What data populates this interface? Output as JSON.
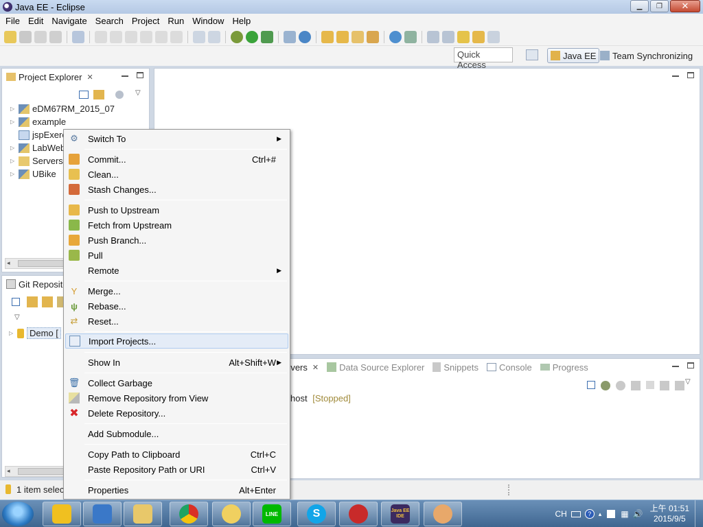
{
  "window": {
    "title": "Java EE - Eclipse"
  },
  "menubar": [
    "File",
    "Edit",
    "Navigate",
    "Search",
    "Project",
    "Run",
    "Window",
    "Help"
  ],
  "quick_access": {
    "placeholder": "Quick Access"
  },
  "perspectives": [
    "Java EE",
    "Team Synchronizing"
  ],
  "project_explorer": {
    "title": "Project Explorer",
    "items": [
      {
        "label": "eDM67RM_2015_07",
        "icon": "web-project-icon",
        "expandable": true
      },
      {
        "label": "example",
        "icon": "web-project-icon",
        "expandable": true
      },
      {
        "label": "jspExerc",
        "icon": "folder-icon",
        "expandable": false
      },
      {
        "label": "LabWeb",
        "icon": "web-project-icon",
        "expandable": true
      },
      {
        "label": "Servers",
        "icon": "folder-open-icon",
        "expandable": true
      },
      {
        "label": "UBike",
        "icon": "web-project-icon",
        "expandable": true
      }
    ]
  },
  "git_repositories": {
    "title": "Git Reposito",
    "repo_label": "Demo [",
    "status": "1 item select"
  },
  "bottom_tabs": {
    "tabs": [
      "rvers",
      "Data Source Explorer",
      "Snippets",
      "Console",
      "Progress"
    ],
    "server_name": "host",
    "server_status": "[Stopped]"
  },
  "context_menu": {
    "items": [
      {
        "label": "Switch To",
        "shortcut": "",
        "submenu": true,
        "icon": "switch-icon"
      },
      {
        "label": "Commit...",
        "shortcut": "Ctrl+#",
        "submenu": false,
        "icon": "commit-icon"
      },
      {
        "label": "Clean...",
        "shortcut": "",
        "submenu": false,
        "icon": "clean-icon"
      },
      {
        "label": "Stash Changes...",
        "shortcut": "",
        "submenu": false,
        "icon": "stash-icon"
      },
      {
        "label": "Push to Upstream",
        "shortcut": "",
        "submenu": false,
        "icon": "push-icon"
      },
      {
        "label": "Fetch from Upstream",
        "shortcut": "",
        "submenu": false,
        "icon": "fetch-icon"
      },
      {
        "label": "Push Branch...",
        "shortcut": "",
        "submenu": false,
        "icon": "push-branch-icon"
      },
      {
        "label": "Pull",
        "shortcut": "",
        "submenu": false,
        "icon": "pull-icon"
      },
      {
        "label": "Remote",
        "shortcut": "",
        "submenu": true,
        "icon": ""
      },
      {
        "label": "Merge...",
        "shortcut": "",
        "submenu": false,
        "icon": "merge-icon"
      },
      {
        "label": "Rebase...",
        "shortcut": "",
        "submenu": false,
        "icon": "rebase-icon"
      },
      {
        "label": "Reset...",
        "shortcut": "",
        "submenu": false,
        "icon": "reset-icon"
      },
      {
        "label": "Import Projects...",
        "shortcut": "",
        "submenu": false,
        "icon": "import-icon"
      },
      {
        "label": "Show In",
        "shortcut": "Alt+Shift+W",
        "submenu": true,
        "icon": ""
      },
      {
        "label": "Collect Garbage",
        "shortcut": "",
        "submenu": false,
        "icon": "trash-icon"
      },
      {
        "label": "Remove Repository from View",
        "shortcut": "",
        "submenu": false,
        "icon": "eraser-icon"
      },
      {
        "label": "Delete Repository...",
        "shortcut": "",
        "submenu": false,
        "icon": "delete-icon"
      },
      {
        "label": "Add Submodule...",
        "shortcut": "",
        "submenu": false,
        "icon": ""
      },
      {
        "label": "Copy Path to Clipboard",
        "shortcut": "Ctrl+C",
        "submenu": false,
        "icon": ""
      },
      {
        "label": "Paste Repository Path or URI",
        "shortcut": "Ctrl+V",
        "submenu": false,
        "icon": ""
      },
      {
        "label": "Properties",
        "shortcut": "Alt+Enter",
        "submenu": false,
        "icon": ""
      }
    ]
  },
  "taskbar": {
    "apps": [
      "app-yellow-icon",
      "code-icon",
      "explorer-icon",
      "chrome-icon",
      "flower-icon",
      "line-icon",
      "skype-icon",
      "robot-icon",
      "java-ee-ide-icon",
      "paint-icon"
    ],
    "java_ee_label": "Java EE IDE",
    "line_label": "LINE",
    "language": "CH",
    "time": "上午 01:51",
    "date": "2015/9/5"
  }
}
